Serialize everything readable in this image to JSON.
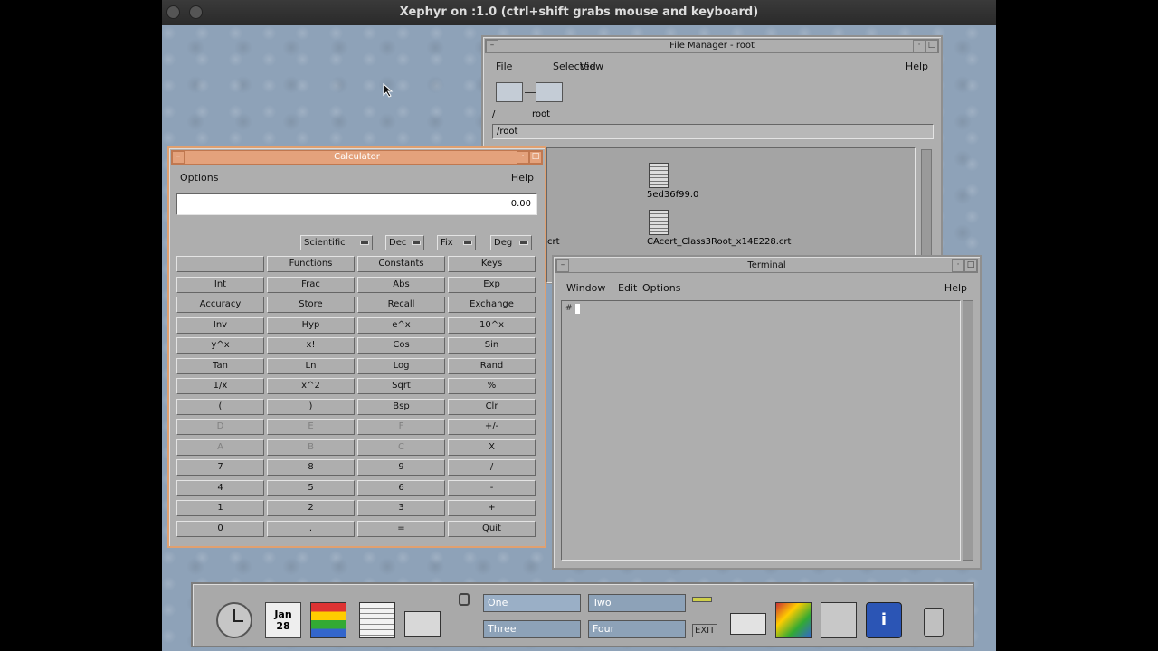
{
  "host": {
    "title": "Xephyr on :1.0 (ctrl+shift grabs mouse and keyboard)"
  },
  "filemanager": {
    "title": "File Manager - root",
    "menu": [
      "File",
      "Selected",
      "View",
      "Help"
    ],
    "path_labels": [
      "/",
      "root"
    ],
    "path": "/root",
    "files": [
      "5ed36f99.0",
      "CAcert_Class3Root_x14E228.crt"
    ],
    "partial_label": "crt"
  },
  "calculator": {
    "title": "Calculator",
    "menu": [
      "Options",
      "Help"
    ],
    "display": "0.00",
    "modes": [
      "Scientific",
      "Dec",
      "Fix",
      "Deg"
    ],
    "keys": [
      [
        "",
        "Functions",
        "Constants",
        "Keys"
      ],
      [
        "Int",
        "Frac",
        "Abs",
        "Exp"
      ],
      [
        "Accuracy",
        "Store",
        "Recall",
        "Exchange"
      ],
      [
        "Inv",
        "Hyp",
        "e^x",
        "10^x"
      ],
      [
        "y^x",
        "x!",
        "Cos",
        "Sin"
      ],
      [
        "Tan",
        "Ln",
        "Log",
        "Rand"
      ],
      [
        "1/x",
        "x^2",
        "Sqrt",
        "%"
      ],
      [
        "(",
        ")",
        "Bsp",
        "Clr"
      ],
      [
        "D",
        "E",
        "F",
        "+/-"
      ],
      [
        "A",
        "B",
        "C",
        "X"
      ],
      [
        "7",
        "8",
        "9",
        "/"
      ],
      [
        "4",
        "5",
        "6",
        "-"
      ],
      [
        "1",
        "2",
        "3",
        "+"
      ],
      [
        "0",
        ".",
        "=",
        "Quit"
      ]
    ]
  },
  "terminal": {
    "title": "Terminal",
    "menu": [
      "Window",
      "Edit",
      "Options",
      "Help"
    ],
    "prompt": "#"
  },
  "panel": {
    "calendar_month": "Jan",
    "calendar_day": "28",
    "workspaces": [
      "One",
      "Two",
      "Three",
      "Four"
    ],
    "exit_label": "EXIT",
    "icons": [
      "clock-icon",
      "calendar-icon",
      "file-manager-icon",
      "text-editor-icon",
      "mailer-icon",
      "lock-icon",
      "printer-icon",
      "style-manager-icon",
      "app-manager-icon",
      "help-icon",
      "trash-icon"
    ]
  }
}
